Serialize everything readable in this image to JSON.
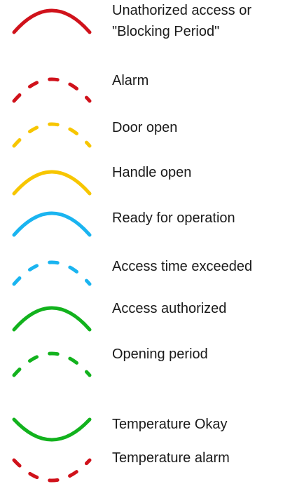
{
  "colors": {
    "red": "#d0121b",
    "yellow": "#f7c600",
    "blue": "#1ab4f0",
    "green": "#12b21d"
  },
  "legend": {
    "items": [
      {
        "lines": [
          "Unathorized access or",
          "\"Blocking Period\""
        ],
        "color": "red",
        "style": "solid",
        "direction": "up",
        "icon": "solid-red-arc-icon"
      },
      {
        "lines": [
          "Alarm"
        ],
        "color": "red",
        "style": "dashed",
        "direction": "up",
        "icon": "dashed-red-arc-icon"
      },
      {
        "lines": [
          "Door open"
        ],
        "color": "yellow",
        "style": "dashed",
        "direction": "up",
        "icon": "dashed-yellow-arc-icon"
      },
      {
        "lines": [
          "Handle open"
        ],
        "color": "yellow",
        "style": "solid",
        "direction": "up",
        "icon": "solid-yellow-arc-icon"
      },
      {
        "lines": [
          "Ready for operation"
        ],
        "color": "blue",
        "style": "solid",
        "direction": "up",
        "icon": "solid-blue-arc-icon"
      },
      {
        "lines": [
          "Access time exceeded"
        ],
        "color": "blue",
        "style": "dashed",
        "direction": "up",
        "icon": "dashed-blue-arc-icon"
      },
      {
        "lines": [
          "Access authorized"
        ],
        "color": "green",
        "style": "solid",
        "direction": "up",
        "icon": "solid-green-arc-icon"
      },
      {
        "lines": [
          "Opening period"
        ],
        "color": "green",
        "style": "dashed",
        "direction": "up",
        "icon": "dashed-green-arc-icon"
      },
      {
        "lines": [
          "Temperature Okay"
        ],
        "color": "green",
        "style": "solid",
        "direction": "down",
        "icon": "solid-green-smile-arc-icon"
      },
      {
        "lines": [
          "Temperature alarm"
        ],
        "color": "red",
        "style": "dashed",
        "direction": "down",
        "icon": "dashed-red-smile-arc-icon"
      }
    ]
  }
}
